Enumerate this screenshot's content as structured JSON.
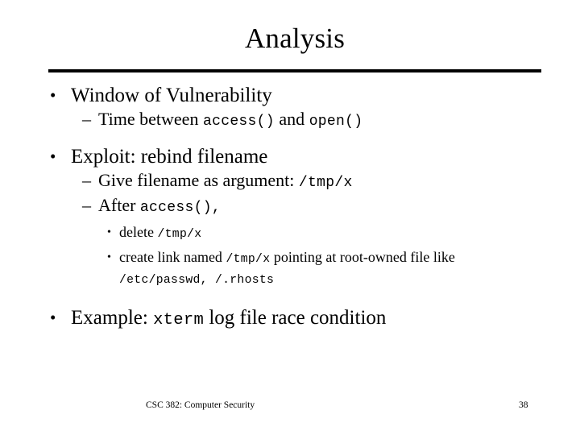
{
  "slide": {
    "title": "Analysis",
    "bullet_marker_l1": "•",
    "bullet_marker_l2": "–",
    "bullet_marker_l3": "•",
    "content": [
      {
        "level": 1,
        "parts": [
          {
            "type": "text",
            "value": "Window of Vulnerability"
          }
        ]
      },
      {
        "level": 2,
        "parts": [
          {
            "type": "text",
            "value": "Time between "
          },
          {
            "type": "code",
            "value": "access()"
          },
          {
            "type": "text",
            "value": " and "
          },
          {
            "type": "code",
            "value": "open()"
          }
        ]
      },
      {
        "level": 1,
        "parts": [
          {
            "type": "text",
            "value": "Exploit: rebind filename"
          }
        ]
      },
      {
        "level": 2,
        "parts": [
          {
            "type": "text",
            "value": "Give filename as argument: "
          },
          {
            "type": "code",
            "value": "/tmp/x"
          }
        ]
      },
      {
        "level": 2,
        "parts": [
          {
            "type": "text",
            "value": "After "
          },
          {
            "type": "code",
            "value": "access(),"
          }
        ]
      },
      {
        "level": 3,
        "parts": [
          {
            "type": "text",
            "value": "delete "
          },
          {
            "type": "code",
            "value": "/tmp/x"
          }
        ]
      },
      {
        "level": 3,
        "parts": [
          {
            "type": "text",
            "value": "create link named "
          },
          {
            "type": "code",
            "value": "/tmp/x"
          },
          {
            "type": "text",
            "value": " pointing at root-owned file like "
          },
          {
            "type": "code",
            "value": "/etc/passwd, /.rhosts"
          }
        ]
      },
      {
        "level": 1,
        "parts": [
          {
            "type": "text",
            "value": "Example: "
          },
          {
            "type": "code",
            "value": "xterm"
          },
          {
            "type": "text",
            "value": " log file race condition"
          }
        ]
      }
    ]
  },
  "footer": {
    "course": "CSC 382: Computer Security",
    "page_number": "38"
  },
  "colors": {
    "text": "#000000",
    "background": "#ffffff",
    "rule": "#000000"
  }
}
